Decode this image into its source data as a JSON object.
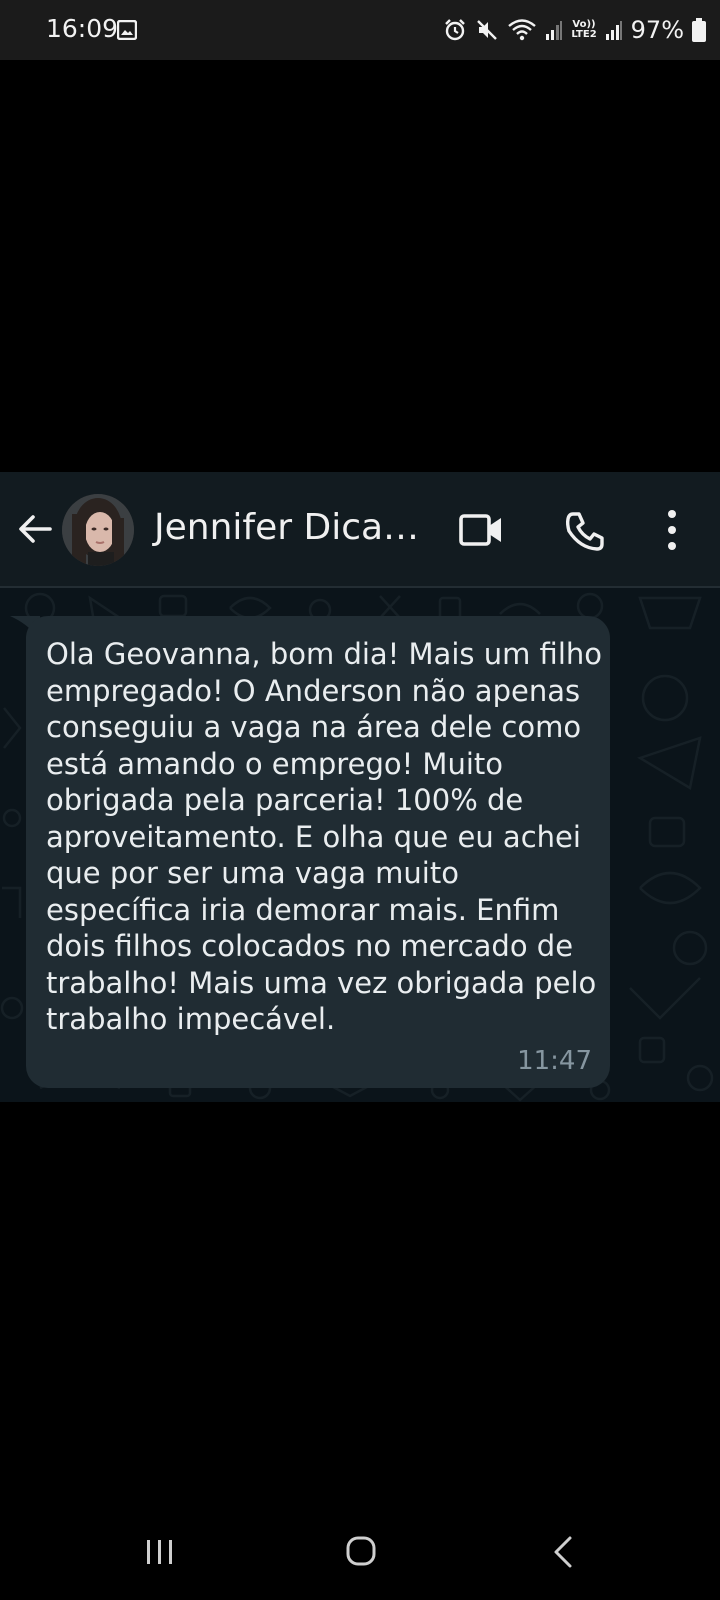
{
  "status_bar": {
    "time": "16:09",
    "lte_top": "Vo))",
    "lte_bottom": "LTE2",
    "battery": "97%",
    "icons": [
      "image-icon",
      "alarm-icon",
      "mute-icon",
      "wifi-icon",
      "signal-icon",
      "signal-icon",
      "battery-icon"
    ]
  },
  "header": {
    "contact_name": "Jennifer Dica…",
    "icons": [
      "back-arrow-icon",
      "avatar",
      "video-call-icon",
      "phone-icon",
      "more-vert-icon"
    ]
  },
  "message": {
    "text": "Ola Geovanna, bom dia! Mais um filho empregado! O Anderson não apenas conseguiu a vaga na área dele como está amando o emprego! Muito obrigada pela parceria! 100% de aproveitamento. E olha que eu achei que por ser uma vaga muito específica iria demorar mais. Enfim dois filhos colocados no mercado de trabalho! Mais uma vez obrigada pelo trabalho impecável.",
    "time": "11:47"
  },
  "nav_bar": {
    "icons": [
      "recents-icon",
      "home-icon",
      "back-icon"
    ]
  },
  "colors": {
    "status_bar_bg": "#1b1b1b",
    "header_bg": "#121b20",
    "chat_bg": "#0b141a",
    "bubble_bg": "#202c33",
    "text": "#e9edef",
    "time_text": "#8696a0"
  }
}
